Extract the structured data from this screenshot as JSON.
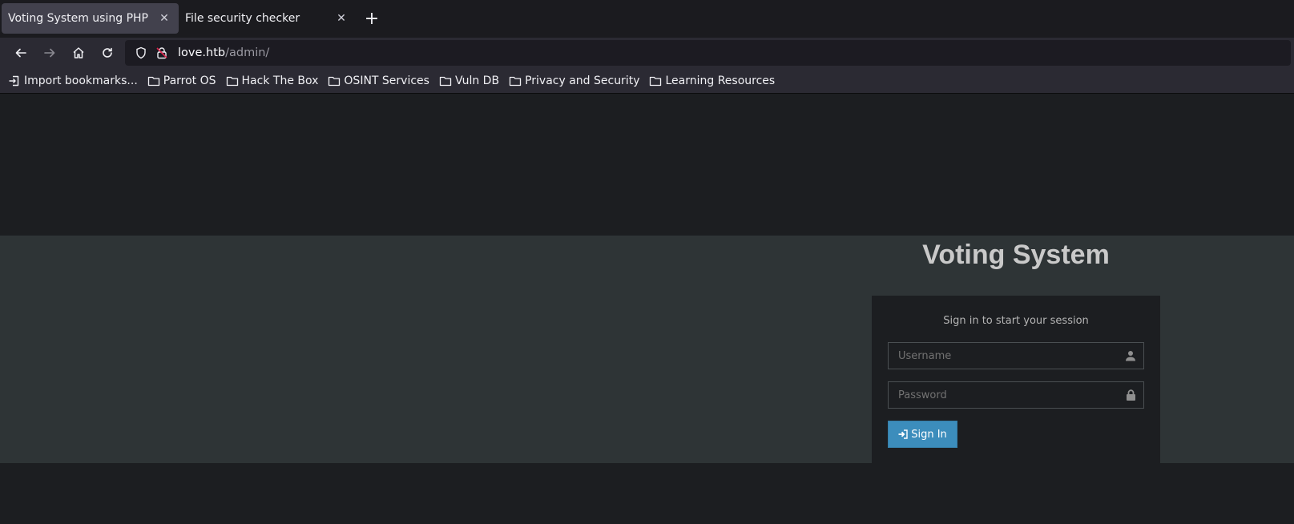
{
  "tabs": [
    {
      "title": "Voting System using PHP",
      "active": true
    },
    {
      "title": "File security checker",
      "active": false
    }
  ],
  "newtab_label": "+",
  "tab_close_glyph": "✕",
  "urlbar": {
    "host": "love.htb",
    "path": "/admin/"
  },
  "bookmarks": [
    {
      "label": "Import bookmarks...",
      "icon": "import-icon"
    },
    {
      "label": "Parrot OS",
      "icon": "folder-icon"
    },
    {
      "label": "Hack The Box",
      "icon": "folder-icon"
    },
    {
      "label": "OSINT Services",
      "icon": "folder-icon"
    },
    {
      "label": "Vuln DB",
      "icon": "folder-icon"
    },
    {
      "label": "Privacy and Security",
      "icon": "folder-icon"
    },
    {
      "label": "Learning Resources",
      "icon": "folder-icon"
    }
  ],
  "login": {
    "title": "Voting System",
    "message": "Sign in to start your session",
    "username_placeholder": "Username",
    "password_placeholder": "Password",
    "signin_label": "Sign In"
  },
  "colors": {
    "band": "#2e3436",
    "page": "#1c1e21",
    "button": "#3c8dbc"
  }
}
